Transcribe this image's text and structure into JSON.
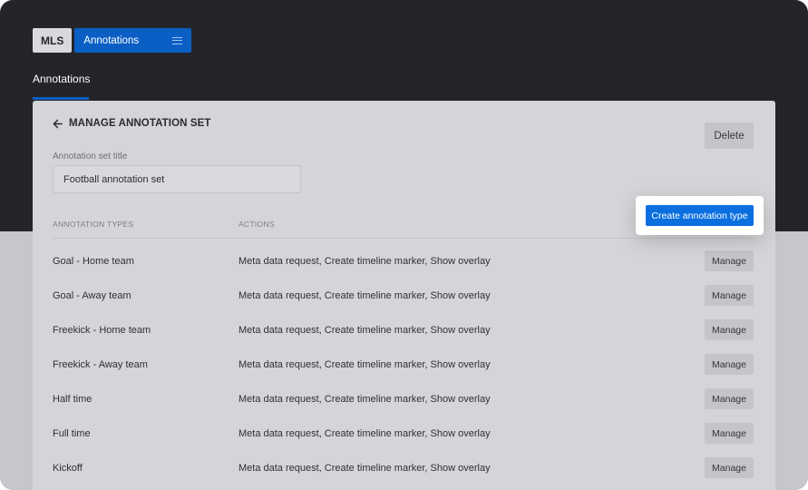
{
  "toolbar": {
    "org_label": "MLS",
    "section_label": "Annotations",
    "menu_icon": "menu-icon"
  },
  "page_tab": "Annotations",
  "card": {
    "back_icon": "arrow-left-icon",
    "title": "MANAGE ANNOTATION SET",
    "delete_label": "Delete",
    "field_label": "Annotation set title",
    "field_value": "Football annotation set",
    "create_label": "Create annotation type",
    "columns": {
      "types": "ANNOTATION TYPES",
      "actions": "ACTIONS"
    },
    "manage_label": "Manage",
    "rows": [
      {
        "name": "Goal - Home team",
        "actions": "Meta data request, Create timeline marker, Show overlay"
      },
      {
        "name": "Goal - Away team",
        "actions": "Meta data request, Create timeline marker, Show overlay"
      },
      {
        "name": "Freekick - Home team",
        "actions": "Meta data request, Create timeline marker, Show overlay"
      },
      {
        "name": "Freekick - Away team",
        "actions": "Meta data request, Create timeline marker, Show overlay"
      },
      {
        "name": "Half time",
        "actions": "Meta data request, Create timeline marker, Show overlay"
      },
      {
        "name": "Full time",
        "actions": "Meta data request, Create timeline marker, Show overlay"
      },
      {
        "name": "Kickoff",
        "actions": "Meta data request, Create timeline marker, Show overlay"
      }
    ]
  },
  "colors": {
    "topbar": "#24252b",
    "accent": "#0b5fc4",
    "primary_button": "#0b6fe0",
    "backdrop": "#c6c7cb"
  }
}
